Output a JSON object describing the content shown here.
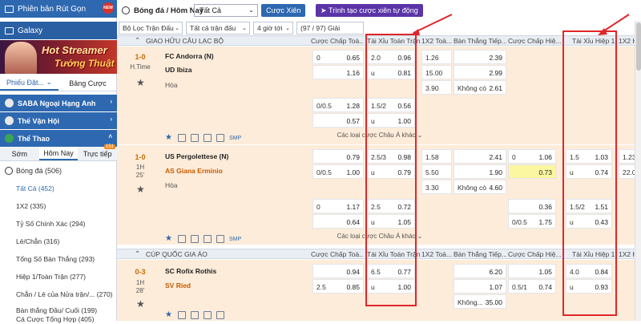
{
  "sidebar": {
    "top_items": [
      {
        "label": "Phiên bản Rút Gọn",
        "badge": "NEW"
      },
      {
        "label": "Galaxy"
      }
    ],
    "banner": {
      "line1": "Hot Streamer",
      "line2": "Tướng Thuật"
    },
    "tabs": [
      "Phiếu Đặt...",
      "Bảng Cược"
    ],
    "sections": [
      "SABA Ngoại Hạng Anh",
      "Thế Vận Hội",
      "Thể Thao"
    ],
    "sport_tabs": [
      {
        "label": "Sớm"
      },
      {
        "label": "Hôm Nay"
      },
      {
        "label": "Trực tiếp",
        "badge": "151"
      }
    ],
    "sport": "Bóng đá (506)",
    "bets": [
      "Tất Cả (452)",
      "1X2 (335)",
      "Tỷ Số Chính Xác (294)",
      "Lẻ/Chẵn (316)",
      "Tổng Số Bàn Thắng (293)",
      "Hiệp 1/Toàn Trận (277)",
      "Chẵn / Lẻ của Nửa trận/...  (270)",
      "Bàn thắng Đầu/ Cuối (199)",
      "Cá Cược Tổng Hợp (405)"
    ]
  },
  "header": {
    "title": "Bóng đá / Hôm Nay",
    "select": "Tất Cả",
    "btn_parlay": "Cược Xiên",
    "btn_builder": "Trình tạo cược xiên tự động"
  },
  "filters": {
    "f1": "Bộ Lọc Trận Đấu",
    "f2": "Tất cả trận đấu",
    "f3": "4 giờ tới",
    "f4": "(97 / 97) Giải"
  },
  "columns": {
    "league_hdr": "GIAO HỮU CÂU LẠC BỘ",
    "c1": "Cược Chấp Toà...",
    "c2": "Tài Xỉu Toàn Trận",
    "c3": "1X2 Toà...",
    "c4": "Bàn Thắng Tiếp...",
    "c5": "Cược Chấp Hiệ...",
    "c6": "Tài Xỉu Hiệp 1",
    "c7": "1X2 H"
  },
  "more_label": "Các loại cược Châu Á khác",
  "smp": "SMP",
  "matches": [
    {
      "score": "1-0",
      "time1": "H.Time",
      "time2": "",
      "home": "FC Andorra (N)",
      "away": "UD Ibiza",
      "draw": "Hòa",
      "ah": [
        [
          "0",
          "0.65"
        ],
        [
          "",
          "1.16"
        ]
      ],
      "ou": [
        [
          "2.0",
          "0.96"
        ],
        [
          "u",
          "0.81"
        ]
      ],
      "x12": [
        "1.26",
        "15.00",
        "3.90"
      ],
      "next": [
        "2.39",
        "2.99",
        "2.61"
      ],
      "next_label": "Không có",
      "ah2": [
        [
          "0/0.5",
          "1.28"
        ],
        [
          "",
          "0.57"
        ]
      ],
      "ou2": [
        [
          "1.5/2",
          "0.56"
        ],
        [
          "u",
          "1.00"
        ]
      ]
    },
    {
      "score": "1-0",
      "time1": "1H",
      "time2": "25'",
      "home": "US Pergolettese (N)",
      "away": "AS Giana Erminio",
      "draw": "Hòa",
      "ah": [
        [
          "",
          "0.79"
        ],
        [
          "0/0.5",
          "1.00"
        ]
      ],
      "ou": [
        [
          "2.5/3",
          "0.98"
        ],
        [
          "u",
          "0.79"
        ]
      ],
      "x12": [
        "1.58",
        "5.50",
        "3.30"
      ],
      "next": [
        "2.41",
        "1.90",
        "4.60"
      ],
      "next_label": "Không có",
      "h1ah": [
        [
          "0",
          "1.06"
        ],
        [
          "",
          "0.73"
        ]
      ],
      "h1ou": [
        [
          "1.5",
          "1.03"
        ],
        [
          "u",
          "0.74"
        ]
      ],
      "h1x": [
        "1.23",
        "22.00"
      ],
      "ah2": [
        [
          "0",
          "1.17"
        ],
        [
          "",
          "0.64"
        ]
      ],
      "ou2": [
        [
          "2.5",
          "0.72"
        ],
        [
          "u",
          "1.05"
        ]
      ],
      "h1ah2": [
        [
          "",
          "0.36"
        ],
        [
          "0/0.5",
          "1.75"
        ]
      ],
      "h1ou2": [
        [
          "1.5/2",
          "1.51"
        ],
        [
          "u",
          "0.43"
        ]
      ]
    }
  ],
  "league2": "CÚP QUỐC GIA ÁO",
  "match3": {
    "score": "0-3",
    "time1": "1H",
    "time2": "28'",
    "home": "SC Rofix Rothis",
    "away": "SV Ried",
    "ah": [
      [
        "",
        "0.94"
      ],
      [
        "2.5",
        "0.85"
      ]
    ],
    "ou": [
      [
        "6.5",
        "0.77"
      ],
      [
        "u",
        "1.00"
      ]
    ],
    "next": [
      "6.20",
      "1.07",
      "35.00"
    ],
    "next_label": "Không...",
    "h1ah": [
      [
        "",
        "1.05"
      ],
      [
        "0.5/1",
        "0.74"
      ]
    ],
    "h1ou": [
      [
        "4.0",
        "0.84"
      ],
      [
        "u",
        "0.93"
      ]
    ]
  }
}
